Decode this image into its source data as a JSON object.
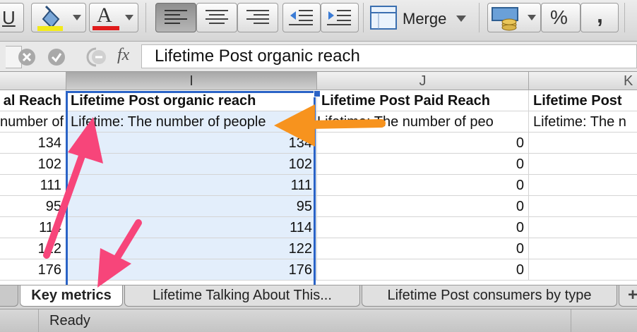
{
  "toolbar": {
    "underline_label": "U",
    "font_color_label": "A",
    "merge_label": "Merge",
    "percent_label": "%",
    "comma_label": ","
  },
  "formula_bar": {
    "fx_label": "fx",
    "value": "Lifetime Post organic reach"
  },
  "columns": {
    "selected": "I",
    "j": "J",
    "k": "K"
  },
  "rows": {
    "header": [
      "al Reach",
      "Lifetime Post organic reach",
      "Lifetime Post Paid Reach",
      "Lifetime Post"
    ],
    "description": [
      "number of",
      "Lifetime: The number of people",
      "Lifetime: The number of peo",
      "Lifetime: The n"
    ],
    "data": [
      [
        "134",
        "134",
        "0"
      ],
      [
        "102",
        "102",
        "0"
      ],
      [
        "111",
        "111",
        "0"
      ],
      [
        "95",
        "95",
        "0"
      ],
      [
        "114",
        "114",
        "0"
      ],
      [
        "122",
        "122",
        "0"
      ],
      [
        "176",
        "176",
        "0"
      ]
    ]
  },
  "sheet_tabs": [
    "Key metrics",
    "Lifetime Talking About This...",
    "Lifetime Post consumers by type"
  ],
  "status": "Ready",
  "colors": {
    "orange_arrow": "#f7931e",
    "pink_arrow": "#f7457a",
    "selection": "#2a63c6"
  }
}
